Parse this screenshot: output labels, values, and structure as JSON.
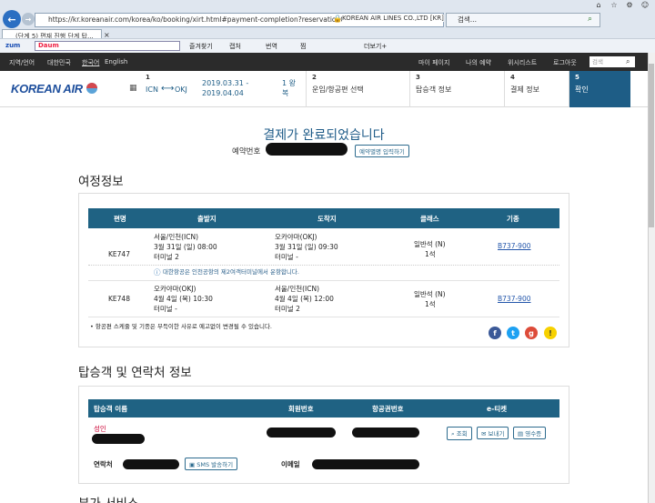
{
  "browser": {
    "url": "https://kr.koreanair.com/korea/ko/booking/xirt.html#payment-completion?reservationCode=B728",
    "site_identity": "KOREAN AIR LINES CO.,LTD [KR]",
    "search_tab": "검색...",
    "tab_title": "(단계 5) 편재 진행 단계 탑...",
    "toolbar": {
      "zum": "zum",
      "daum": "Daum",
      "favorites": "즐겨찾기",
      "capture": "캡처",
      "translate": "번역",
      "wish": "찜",
      "more": "더보기+"
    }
  },
  "topbar": {
    "left": [
      "지역/언어",
      "대한민국",
      "한국어",
      "English"
    ],
    "right": [
      "마이 페이지",
      "나의 예약",
      "위시리스트",
      "로그아웃"
    ],
    "search_placeholder": "검색"
  },
  "header": {
    "logo": "KOREAN AIR",
    "route": {
      "from": "ICN",
      "to": "OKJ",
      "dates": "2019.03.31 -\n2019.04.04",
      "trip": "1 왕\n복"
    },
    "steps": [
      {
        "num": "2",
        "label": "운임/항공편 선택"
      },
      {
        "num": "3",
        "label": "탑승객 정보"
      },
      {
        "num": "4",
        "label": "결제 정보"
      },
      {
        "num": "5",
        "label": "확인"
      }
    ],
    "step1_num": "1"
  },
  "confirm": {
    "title": "결제가 완료되었습니다",
    "reservation_label": "예약번호",
    "copy_button": "예약별명 입력하기"
  },
  "itinerary": {
    "section_title": "여정정보",
    "headers": [
      "편명",
      "출발지",
      "도착지",
      "클래스",
      "기종"
    ],
    "rows": [
      {
        "flight": "KE747",
        "dep_city": "서울/인천(ICN)",
        "dep_time": "3월 31일 (일)  08:00",
        "dep_term": "터미널  2",
        "arr_city": "오카야마(OKJ)",
        "arr_time": "3월 31일 (일)  09:30",
        "arr_term": "터미널 -",
        "class": "일반석 (N)",
        "seats": "1석",
        "aircraft": "B737-900",
        "notice": "대한항공은 인천공항의 제2여객터미널에서 운항합니다."
      },
      {
        "flight": "KE748",
        "dep_city": "오카야마(OKJ)",
        "dep_time": "4월 4일 (목)  10:30",
        "dep_term": "터미널 -",
        "arr_city": "서울/인천(ICN)",
        "arr_time": "4월 4일 (목)  12:00",
        "arr_term": "터미널  2",
        "class": "일반석 (N)",
        "seats": "1석",
        "aircraft": "B737-900"
      }
    ],
    "footnote": "항공편 스케줄 및 기종은 부득이한 사유로 예고없이 변경될 수 있습니다."
  },
  "passenger": {
    "section_title": "탑승객 및 연락처 정보",
    "headers": [
      "탑승객 이름",
      "회원번호",
      "항공권번호",
      "e-티켓"
    ],
    "name_label": "성인",
    "eticket_buttons": [
      "조회",
      "보내기",
      "영수증"
    ],
    "contact_label": "연락처",
    "sms_button": "SMS 발송하기",
    "email_label": "이메일"
  },
  "next_section": "부가 서비스",
  "colors": {
    "primary": "#1e5d86",
    "table_header": "#1f6283",
    "brand": "#1d4e9c"
  }
}
